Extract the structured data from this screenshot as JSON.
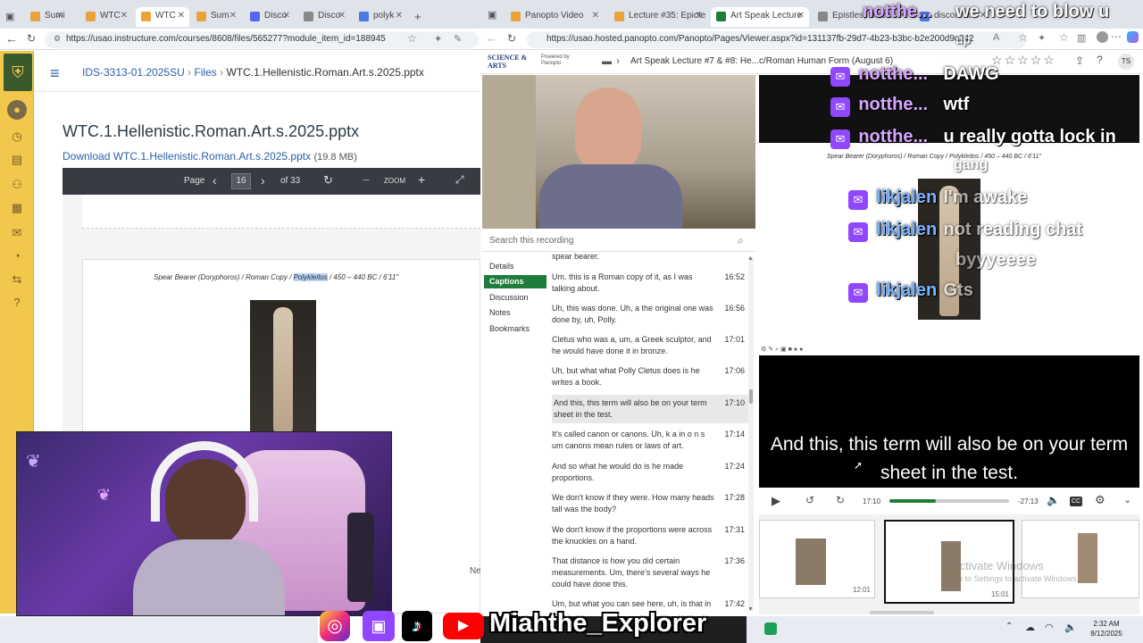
{
  "left_browser": {
    "tabs": [
      "Sumi",
      "WTC",
      "WTC",
      "Sum",
      "Disco",
      "Disco",
      "polyk"
    ],
    "url": "https://usao.instructure.com/courses/8608/files/565277?module_item_id=188945",
    "breadcrumb": {
      "course": "IDS-3313-01.2025SU",
      "files": "Files",
      "file": "WTC.1.Hellenistic.Roman.Art.s.2025.pptx"
    },
    "title": "WTC.1.Hellenistic.Roman.Art.s.2025.pptx",
    "download_label": "Download WTC.1.Hellenistic.Roman.Art.s.2025.pptx",
    "file_size": "(19.8 MB)",
    "viewer": {
      "page_label": "Page",
      "page_value": "16",
      "of_pages": "of 33",
      "zoom_label": "ZOOM"
    },
    "slide_caption_prefix": "Spear Bearer (Doryphoros) / Roman Copy / ",
    "slide_caption_highlight": "Polykleitos",
    "slide_caption_suffix": " / 450 – 440 BC / 6'11\"",
    "next_partial": "Ne"
  },
  "right_browser": {
    "tabs": [
      "Panopto Video",
      "Lecture #35: Epicte",
      "Art Speak Lecture",
      "Epistles, Disco",
      "discourse"
    ],
    "url": "https://usao.hosted.panopto.com/Panopto/Pages/Viewer.aspx?id=131137fb-29d7-4b23-b3bc-b2e200d9c242",
    "brand_main": "SCIENCE & ARTS",
    "brand_powered": "Powered by",
    "brand_panopto": "Panopto",
    "session_title": "Art Speak Lecture #7 & #8: He...c/Roman Human Form (August 6)",
    "user_initials": "TS"
  },
  "panopto": {
    "search_placeholder": "Search this recording",
    "nav": [
      "Details",
      "Captions",
      "Discussion",
      "Notes",
      "Bookmarks"
    ],
    "top_partial": "spear bearer.",
    "captions": [
      {
        "text": "Um. this is a Roman copy of it, as I was talking about.",
        "time": "16:52"
      },
      {
        "text": "Uh, this was done. Uh, a the original one was done by, uh, Polly.",
        "time": "16:56"
      },
      {
        "text": "Cletus who was a, um, a Greek sculptor, and he would have done it in bronze.",
        "time": "17:01"
      },
      {
        "text": "Uh, but what what Polly Cletus does is he writes a book.",
        "time": "17:06"
      },
      {
        "text": "And this, this term will also be on your term sheet in the test.",
        "time": "17:10"
      },
      {
        "text": "It's called canon or canons. Uh, k a in o n s um canons mean rules or laws of art.",
        "time": "17:14"
      },
      {
        "text": "And so what he would do is he made proportions.",
        "time": "17:24"
      },
      {
        "text": "We don't know if they were. How many heads tall was the body?",
        "time": "17:28"
      },
      {
        "text": "We don't know if the proportions were across the knuckles on a hand.",
        "time": "17:31"
      },
      {
        "text": "That distance is how you did certain measurements. Um, there's several ways he could have done this.",
        "time": "17:36"
      },
      {
        "text": "Um, but what you can see here, uh, is that in the marble version we have to have some",
        "time": "17:42"
      }
    ],
    "slide_caption": "Spear Bearer (Doryphoros) / Roman Copy / Polykleitos / 450 – 440 BC / 6'11\"",
    "subtitle": "And this, this term will also be on your term sheet in the test.",
    "current_time": "17:10",
    "remaining_time": "-27:13",
    "progress": 0.39,
    "thumb_times": [
      "12:01",
      "15:01",
      ""
    ]
  },
  "chat": [
    {
      "user": "notthe...",
      "msg": "DAWG"
    },
    {
      "user": "notthe...",
      "msg": "wtf"
    },
    {
      "user": "notthe...",
      "msg": "u really gotta lock in"
    },
    {
      "user": "",
      "msg": "gang"
    },
    {
      "user": "likjalen",
      "msg": "I'm awake"
    },
    {
      "user": "likjalen",
      "msg": "not reading chat"
    },
    {
      "user": "",
      "msg": "byyyeeee"
    },
    {
      "user": "likjalen",
      "msg": "Gts"
    }
  ],
  "overlay_top": {
    "user": "notthe...",
    "msg": "we need to blow u",
    "wrap": "up"
  },
  "streamer_name": "Miahthe_Explorer",
  "activate": {
    "title": "Activate Windows",
    "sub": "Go to Settings to activate Windows."
  },
  "taskbar": {
    "time": "2:32 AM",
    "date": "8/12/2025"
  },
  "colors": {
    "panopto_green": "#1e7d3a",
    "canvas_link": "#2d5fa8",
    "twitch_purple": "#9146ff",
    "subtitle_bg": "#000000"
  }
}
